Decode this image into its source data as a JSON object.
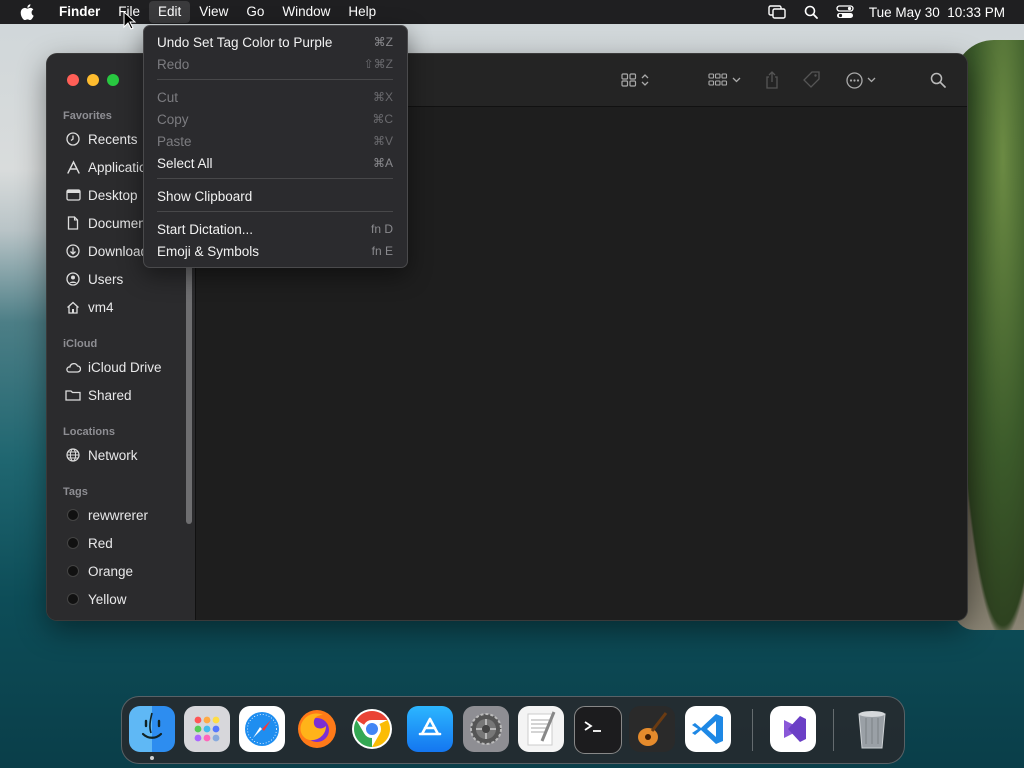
{
  "menubar": {
    "app": "Finder",
    "items": [
      "File",
      "Edit",
      "View",
      "Go",
      "Window",
      "Help"
    ],
    "clock": "Tue May 30  10:33 PM"
  },
  "edit_menu": {
    "undo": {
      "label": "Undo Set Tag Color to Purple",
      "shortcut": "⌘Z"
    },
    "redo": {
      "label": "Redo",
      "shortcut": "⇧⌘Z"
    },
    "cut": {
      "label": "Cut",
      "shortcut": "⌘X"
    },
    "copy": {
      "label": "Copy",
      "shortcut": "⌘C"
    },
    "paste": {
      "label": "Paste",
      "shortcut": "⌘V"
    },
    "select_all": {
      "label": "Select All",
      "shortcut": "⌘A"
    },
    "show_clipboard": {
      "label": "Show Clipboard"
    },
    "start_dictation": {
      "label": "Start Dictation...",
      "shortcut": "fn D"
    },
    "emoji": {
      "label": "Emoji & Symbols",
      "shortcut": "fn E"
    }
  },
  "sidebar": {
    "favorites_title": "Favorites",
    "favorites": [
      "Recents",
      "Applications",
      "Desktop",
      "Documents",
      "Downloads",
      "Users",
      "vm4"
    ],
    "icloud_title": "iCloud",
    "icloud": [
      "iCloud Drive",
      "Shared"
    ],
    "locations_title": "Locations",
    "locations": [
      "Network"
    ],
    "tags_title": "Tags",
    "tags": [
      "rewwrerer",
      "Red",
      "Orange",
      "Yellow"
    ]
  },
  "colors": {
    "close": "#ff5f57",
    "minimize": "#febc2e",
    "zoom": "#28c840",
    "accent": "#3a3a3c"
  }
}
